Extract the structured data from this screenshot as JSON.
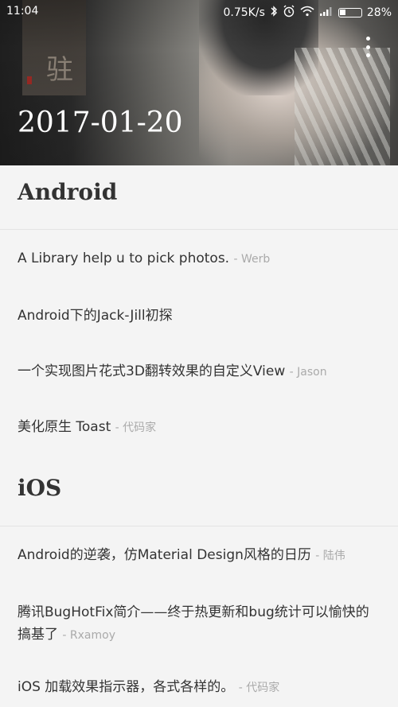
{
  "status_bar": {
    "time": "11:04",
    "net_speed": "0.75K/s",
    "battery": "28%",
    "battery_level": 0.28
  },
  "header": {
    "date": "2017-01-20",
    "calligraphy_char": "驻"
  },
  "sections": [
    {
      "title": "Android",
      "items": [
        {
          "title": "A Library help u to pick photos.",
          "author": "- Werb"
        },
        {
          "title": "Android下的Jack-Jill初探",
          "author": ""
        },
        {
          "title": " 一个实现图片花式3D翻转效果的自定义View",
          "author": "- Jason"
        },
        {
          "title": "美化原生 Toast",
          "author": "- 代码家"
        }
      ]
    },
    {
      "title": "iOS",
      "items": [
        {
          "title": "Android的逆袭，仿Material Design风格的日历",
          "author": "- 陆伟"
        },
        {
          "title": "腾讯BugHotFix简介——终于热更新和bug统计可以愉快的搞基了",
          "author": "- Rxamoy"
        },
        {
          "title": "iOS 加载效果指示器，各式各样的。",
          "author": "- 代码家"
        }
      ]
    }
  ],
  "colors": {
    "background": "#f4f4f4",
    "text": "#333333",
    "author": "#aaaaaa"
  }
}
